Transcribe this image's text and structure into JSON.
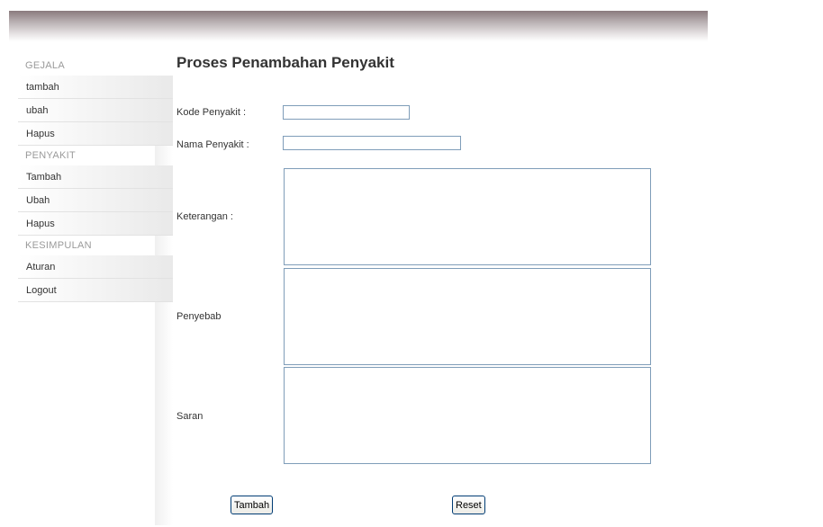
{
  "sidebar": {
    "sections": [
      {
        "title": "GEJALA",
        "items": [
          "tambah",
          "ubah",
          "Hapus"
        ]
      },
      {
        "title": "PENYAKIT",
        "items": [
          "Tambah",
          "Ubah",
          "Hapus"
        ]
      },
      {
        "title": "KESIMPULAN",
        "items": [
          "Aturan",
          "Logout"
        ]
      }
    ]
  },
  "form": {
    "title": "Proses Penambahan Penyakit",
    "kode_label": "Kode Penyakit :",
    "kode_value": "",
    "nama_label": "Nama Penyakit :",
    "nama_value": "",
    "keterangan_label": "Keterangan :",
    "penyebab_label": "Penyebab",
    "saran_label": "Saran",
    "submit_label": "Tambah",
    "reset_label": "Reset"
  },
  "colors": {
    "header_dark": "#8a7a7d",
    "input_border": "#7f9db9",
    "button_border": "#003c74"
  }
}
